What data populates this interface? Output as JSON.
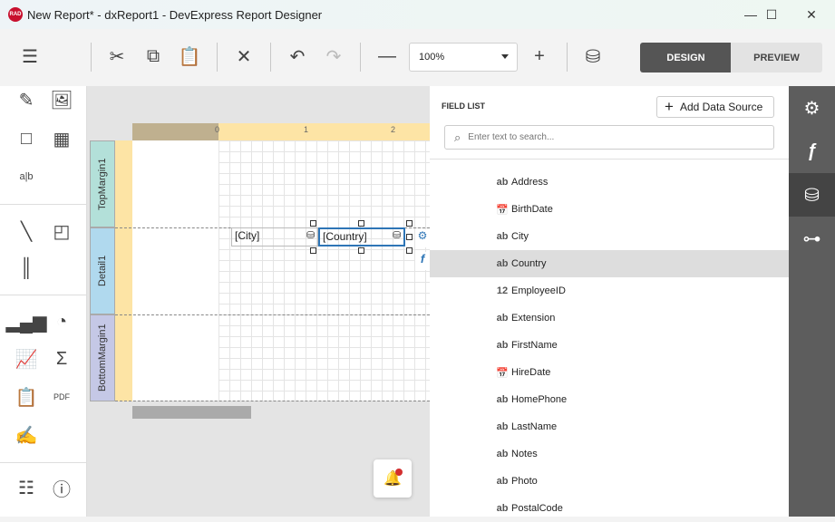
{
  "window": {
    "title": "New Report* - dxReport1 - DevExpress Report Designer",
    "logo": "RAD"
  },
  "toolbar": {
    "zoom": "100%",
    "design": "DESIGN",
    "preview": "PREVIEW"
  },
  "canvas": {
    "bands": [
      "TopMargin1",
      "Detail1",
      "BottomMargin1"
    ],
    "ruler_ticks": [
      "0",
      "1",
      "2"
    ],
    "cells": [
      {
        "text": "[City]"
      },
      {
        "text": "[Country]"
      }
    ]
  },
  "field_list": {
    "title": "FIELD LIST",
    "add_label": "Add Data Source",
    "search_placeholder": "Enter text to search...",
    "fields": [
      {
        "type": "ab",
        "name": "Address"
      },
      {
        "type": "date",
        "name": "BirthDate"
      },
      {
        "type": "ab",
        "name": "City"
      },
      {
        "type": "ab",
        "name": "Country",
        "selected": true
      },
      {
        "type": "12",
        "name": "EmployeeID"
      },
      {
        "type": "ab",
        "name": "Extension"
      },
      {
        "type": "ab",
        "name": "FirstName"
      },
      {
        "type": "date",
        "name": "HireDate"
      },
      {
        "type": "ab",
        "name": "HomePhone"
      },
      {
        "type": "ab",
        "name": "LastName"
      },
      {
        "type": "ab",
        "name": "Notes"
      },
      {
        "type": "ab",
        "name": "Photo"
      },
      {
        "type": "ab",
        "name": "PostalCode"
      }
    ]
  },
  "colors": {
    "accent": "#2e75b6",
    "topmargin": "#b3e0d9",
    "detail": "#b0d9ee",
    "bottommargin": "#c5c8e6",
    "ruler": "#fde4a5"
  }
}
